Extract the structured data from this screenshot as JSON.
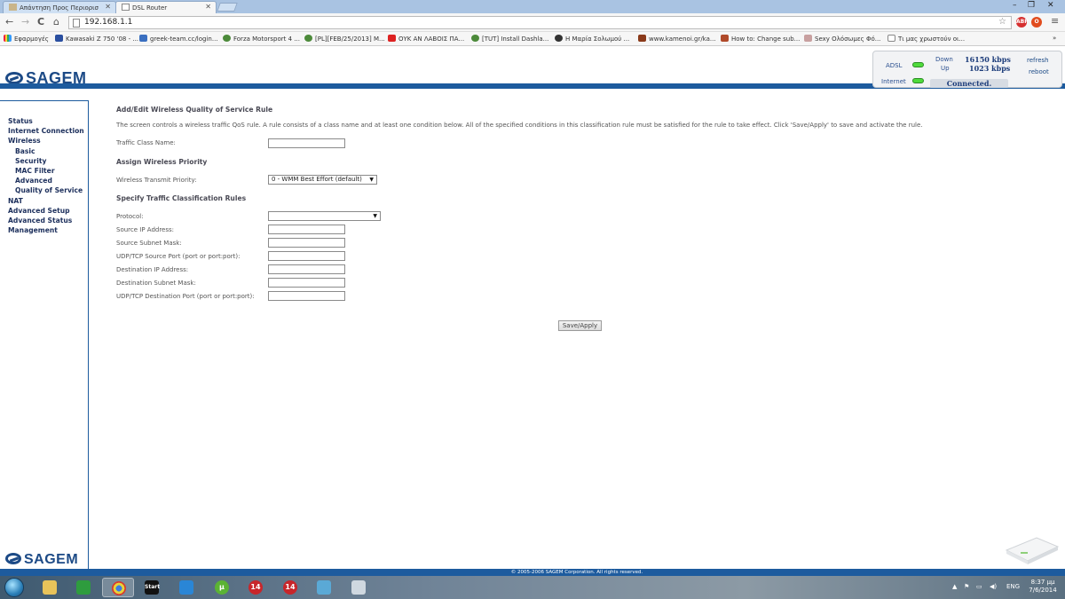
{
  "browser": {
    "tabs": [
      {
        "label": "Απάντηση Προς Περιορισ",
        "active": false
      },
      {
        "label": "DSL Router",
        "active": true
      }
    ],
    "url": "192.168.1.1",
    "bookmarks": [
      "Εφαρμογές",
      "Kawasaki Z 750 '08 - ...",
      "greek-team.cc/login...",
      "Forza Motorsport 4 ...",
      "[PL][FEB/25/2013] M...",
      "ΟΥΚ ΑΝ ΛΑΒΟΙΣ ΠΑ...",
      "[TUT] Install Dashla...",
      "Η Μαρία Σολωμού ...",
      "www.kamenoi.gr/ka...",
      "How to: Change sub...",
      "Sexy Ολόσωμες Φό...",
      "Τι μας χρωστούν οι..."
    ],
    "bookmarks_more": "»"
  },
  "router": {
    "brand": "SAGEM",
    "status": {
      "adsl_label": "ADSL",
      "internet_label": "Internet",
      "down_label": "Down",
      "up_label": "Up",
      "down_value": "16150 kbps",
      "up_value": "1023 kbps",
      "connection": "Connected.",
      "refresh_label": "refresh",
      "reboot_label": "reboot"
    },
    "nav": [
      {
        "label": "Status",
        "sub": false
      },
      {
        "label": "Internet Connection",
        "sub": false
      },
      {
        "label": "Wireless",
        "sub": false
      },
      {
        "label": "Basic",
        "sub": true
      },
      {
        "label": "Security",
        "sub": true
      },
      {
        "label": "MAC Filter",
        "sub": true
      },
      {
        "label": "Advanced",
        "sub": true
      },
      {
        "label": "Quality of Service",
        "sub": true
      },
      {
        "label": "NAT",
        "sub": false
      },
      {
        "label": "Advanced Setup",
        "sub": false
      },
      {
        "label": "Advanced Status",
        "sub": false
      },
      {
        "label": "Management",
        "sub": false
      }
    ],
    "content": {
      "title": "Add/Edit Wireless Quality of Service Rule",
      "description": "The screen controls  a wireless traffic QoS rule. A rule consists of a class name and at least one condition below. All of the specified conditions in this classification rule must be satisfied for the rule to take effect. Click 'Save/Apply' to save and activate the rule.",
      "traffic_class_label": "Traffic Class Name:",
      "traffic_class_value": "",
      "assign_heading": "Assign Wireless Priority",
      "priority_label": "Wireless Transmit Priority:",
      "priority_value": "0 - WMM Best Effort (default)",
      "specify_heading": "Specify Traffic Classification Rules",
      "protocol_label": "Protocol:",
      "protocol_value": "",
      "fields": [
        {
          "label": "Source IP Address:",
          "value": ""
        },
        {
          "label": "Source Subnet Mask:",
          "value": ""
        },
        {
          "label": "UDP/TCP Source Port (port or port:port):",
          "value": ""
        },
        {
          "label": "Destination IP Address:",
          "value": ""
        },
        {
          "label": "Destination Subnet Mask:",
          "value": ""
        },
        {
          "label": "UDP/TCP Destination Port (port or port:port):",
          "value": ""
        }
      ],
      "save_label": "Save/Apply"
    },
    "footer": "© 2005-2006 SAGEM Corporation. All rights reserved."
  },
  "taskbar": {
    "tray_lang": "ENG",
    "time": "8:37 μμ",
    "date": "7/6/2014"
  },
  "colors": {
    "brand_blue": "#1d5b9e",
    "nav_text": "#1c2f5c",
    "led_green": "#4fdb3c"
  }
}
